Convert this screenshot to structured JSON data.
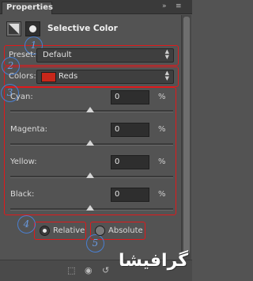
{
  "panel": {
    "tab_title": "Properties",
    "menu_icons": [
      "double-chevron-icon",
      "menu-icon"
    ]
  },
  "header": {
    "title": "Selective Color",
    "icons": [
      "adjustment-layer-icon",
      "mask-icon"
    ]
  },
  "preset": {
    "label": "Preset:",
    "value": "Default"
  },
  "colors": {
    "label": "Colors:",
    "value": "Reds",
    "swatch": "#c8271a"
  },
  "sliders": [
    {
      "label": "Cyan:",
      "value": "0",
      "unit": "%",
      "position": 0.5
    },
    {
      "label": "Magenta:",
      "value": "0",
      "unit": "%",
      "position": 0.5
    },
    {
      "label": "Yellow:",
      "value": "0",
      "unit": "%",
      "position": 0.5
    },
    {
      "label": "Black:",
      "value": "0",
      "unit": "%",
      "position": 0.5
    }
  ],
  "method": {
    "relative_label": "Relative",
    "absolute_label": "Absolute",
    "selected": "Relative"
  },
  "annotations": [
    "1",
    "2",
    "3",
    "4",
    "5"
  ],
  "watermark": "گرافیشا",
  "colors_accent": {
    "annotation_box": "#e0191b",
    "annotation_circle": "#4a7fd0"
  }
}
